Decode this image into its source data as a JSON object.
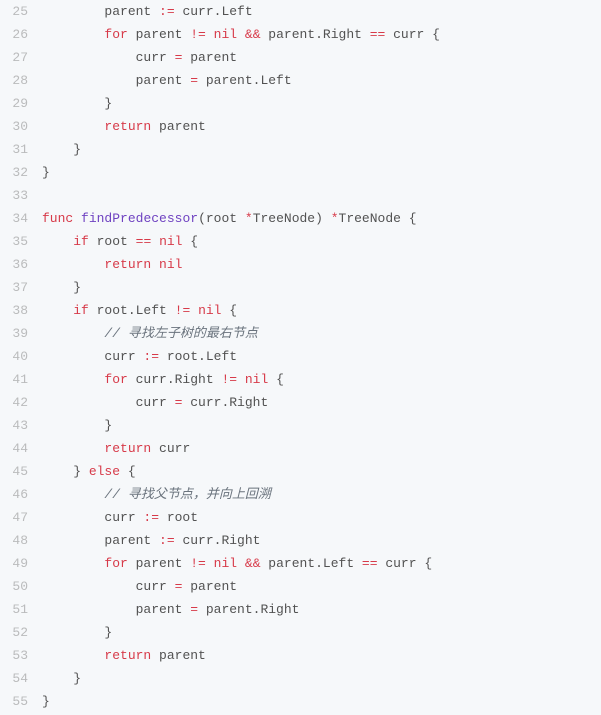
{
  "code": {
    "lines": [
      {
        "num": "25",
        "tokens": [
          {
            "t": "        parent "
          },
          {
            "t": ":=",
            "c": "op"
          },
          {
            "t": " curr.Left"
          }
        ]
      },
      {
        "num": "26",
        "tokens": [
          {
            "t": "        "
          },
          {
            "t": "for",
            "c": "k"
          },
          {
            "t": " parent "
          },
          {
            "t": "!=",
            "c": "op"
          },
          {
            "t": " "
          },
          {
            "t": "nil",
            "c": "k"
          },
          {
            "t": " "
          },
          {
            "t": "&&",
            "c": "op"
          },
          {
            "t": " parent.Right "
          },
          {
            "t": "==",
            "c": "op"
          },
          {
            "t": " curr {"
          }
        ]
      },
      {
        "num": "27",
        "tokens": [
          {
            "t": "            curr "
          },
          {
            "t": "=",
            "c": "op"
          },
          {
            "t": " parent"
          }
        ]
      },
      {
        "num": "28",
        "tokens": [
          {
            "t": "            parent "
          },
          {
            "t": "=",
            "c": "op"
          },
          {
            "t": " parent.Left"
          }
        ]
      },
      {
        "num": "29",
        "tokens": [
          {
            "t": "        }"
          }
        ]
      },
      {
        "num": "30",
        "tokens": [
          {
            "t": "        "
          },
          {
            "t": "return",
            "c": "k"
          },
          {
            "t": " parent"
          }
        ]
      },
      {
        "num": "31",
        "tokens": [
          {
            "t": "    }"
          }
        ]
      },
      {
        "num": "32",
        "tokens": [
          {
            "t": "}"
          }
        ]
      },
      {
        "num": "33",
        "tokens": [
          {
            "t": ""
          }
        ]
      },
      {
        "num": "34",
        "tokens": [
          {
            "t": "func",
            "c": "k"
          },
          {
            "t": " "
          },
          {
            "t": "findPredecessor",
            "c": "fn"
          },
          {
            "t": "(root "
          },
          {
            "t": "*",
            "c": "op"
          },
          {
            "t": "TreeNode) "
          },
          {
            "t": "*",
            "c": "op"
          },
          {
            "t": "TreeNode {"
          }
        ]
      },
      {
        "num": "35",
        "tokens": [
          {
            "t": "    "
          },
          {
            "t": "if",
            "c": "k"
          },
          {
            "t": " root "
          },
          {
            "t": "==",
            "c": "op"
          },
          {
            "t": " "
          },
          {
            "t": "nil",
            "c": "k"
          },
          {
            "t": " {"
          }
        ]
      },
      {
        "num": "36",
        "tokens": [
          {
            "t": "        "
          },
          {
            "t": "return",
            "c": "k"
          },
          {
            "t": " "
          },
          {
            "t": "nil",
            "c": "k"
          }
        ]
      },
      {
        "num": "37",
        "tokens": [
          {
            "t": "    }"
          }
        ]
      },
      {
        "num": "38",
        "tokens": [
          {
            "t": "    "
          },
          {
            "t": "if",
            "c": "k"
          },
          {
            "t": " root.Left "
          },
          {
            "t": "!=",
            "c": "op"
          },
          {
            "t": " "
          },
          {
            "t": "nil",
            "c": "k"
          },
          {
            "t": " {"
          }
        ]
      },
      {
        "num": "39",
        "tokens": [
          {
            "t": "        "
          },
          {
            "t": "// 寻找左子树的最右节点",
            "c": "cm"
          }
        ]
      },
      {
        "num": "40",
        "tokens": [
          {
            "t": "        curr "
          },
          {
            "t": ":=",
            "c": "op"
          },
          {
            "t": " root.Left"
          }
        ]
      },
      {
        "num": "41",
        "tokens": [
          {
            "t": "        "
          },
          {
            "t": "for",
            "c": "k"
          },
          {
            "t": " curr.Right "
          },
          {
            "t": "!=",
            "c": "op"
          },
          {
            "t": " "
          },
          {
            "t": "nil",
            "c": "k"
          },
          {
            "t": " {"
          }
        ]
      },
      {
        "num": "42",
        "tokens": [
          {
            "t": "            curr "
          },
          {
            "t": "=",
            "c": "op"
          },
          {
            "t": " curr.Right"
          }
        ]
      },
      {
        "num": "43",
        "tokens": [
          {
            "t": "        }"
          }
        ]
      },
      {
        "num": "44",
        "tokens": [
          {
            "t": "        "
          },
          {
            "t": "return",
            "c": "k"
          },
          {
            "t": " curr"
          }
        ]
      },
      {
        "num": "45",
        "tokens": [
          {
            "t": "    } "
          },
          {
            "t": "else",
            "c": "k"
          },
          {
            "t": " {"
          }
        ]
      },
      {
        "num": "46",
        "tokens": [
          {
            "t": "        "
          },
          {
            "t": "// 寻找父节点，并向上回溯",
            "c": "cm"
          }
        ]
      },
      {
        "num": "47",
        "tokens": [
          {
            "t": "        curr "
          },
          {
            "t": ":=",
            "c": "op"
          },
          {
            "t": " root"
          }
        ]
      },
      {
        "num": "48",
        "tokens": [
          {
            "t": "        parent "
          },
          {
            "t": ":=",
            "c": "op"
          },
          {
            "t": " curr.Right"
          }
        ]
      },
      {
        "num": "49",
        "tokens": [
          {
            "t": "        "
          },
          {
            "t": "for",
            "c": "k"
          },
          {
            "t": " parent "
          },
          {
            "t": "!=",
            "c": "op"
          },
          {
            "t": " "
          },
          {
            "t": "nil",
            "c": "k"
          },
          {
            "t": " "
          },
          {
            "t": "&&",
            "c": "op"
          },
          {
            "t": " parent.Left "
          },
          {
            "t": "==",
            "c": "op"
          },
          {
            "t": " curr {"
          }
        ]
      },
      {
        "num": "50",
        "tokens": [
          {
            "t": "            curr "
          },
          {
            "t": "=",
            "c": "op"
          },
          {
            "t": " parent"
          }
        ]
      },
      {
        "num": "51",
        "tokens": [
          {
            "t": "            parent "
          },
          {
            "t": "=",
            "c": "op"
          },
          {
            "t": " parent.Right"
          }
        ]
      },
      {
        "num": "52",
        "tokens": [
          {
            "t": "        }"
          }
        ]
      },
      {
        "num": "53",
        "tokens": [
          {
            "t": "        "
          },
          {
            "t": "return",
            "c": "k"
          },
          {
            "t": " parent"
          }
        ]
      },
      {
        "num": "54",
        "tokens": [
          {
            "t": "    }"
          }
        ]
      },
      {
        "num": "55",
        "tokens": [
          {
            "t": "}"
          }
        ]
      }
    ]
  }
}
